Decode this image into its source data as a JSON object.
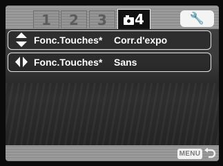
{
  "tabs": {
    "items": [
      {
        "label": "1"
      },
      {
        "label": "2"
      },
      {
        "label": "3"
      },
      {
        "label": "4",
        "icon": "camera-icon",
        "active": true
      }
    ],
    "setup_icon": "wrench-icon",
    "setup_glyph": "🔧"
  },
  "menu": {
    "rows": [
      {
        "icon": "up-down-arrows-icon",
        "label": "Fonc.Touches*",
        "value": "Corr.d'expo"
      },
      {
        "icon": "left-right-arrows-icon",
        "label": "Fonc.Touches*",
        "value": "Sans"
      }
    ]
  },
  "footer": {
    "menu_button_label": "MENU",
    "back_icon": "return-arrow-icon"
  },
  "colors": {
    "bar_gray": "#969696",
    "active_tab": "#111111",
    "row_border": "#e6e6e6",
    "text": "#ffffff"
  }
}
